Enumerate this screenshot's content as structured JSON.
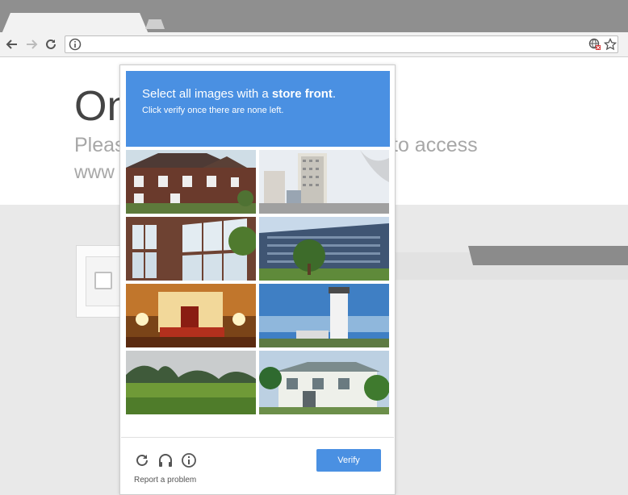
{
  "browser": {
    "tabs": [
      {
        "label": ""
      }
    ],
    "address": {
      "value": ""
    }
  },
  "page": {
    "heading": "On",
    "subtitle_left": "Pleas",
    "subtitle_right": "to access",
    "url_fragment": "www"
  },
  "challenge": {
    "instruction_prefix": "Select all images with a ",
    "instruction_target": "store front",
    "instruction_suffix": ".",
    "sub_instruction": "Click verify once there are none left.",
    "header_color": "#4a90e2",
    "tiles": [
      {
        "subject": "brick-house"
      },
      {
        "subject": "tower-buildings"
      },
      {
        "subject": "brick-building-windows"
      },
      {
        "subject": "office-building"
      },
      {
        "subject": "decorated-hall"
      },
      {
        "subject": "lighthouse"
      },
      {
        "subject": "rice-field-hills"
      },
      {
        "subject": "white-villa"
      }
    ],
    "footer": {
      "reload_icon": "reload-icon",
      "audio_icon": "headphones-icon",
      "info_icon": "info-icon",
      "verify_label": "Verify",
      "report_label": "Report a problem"
    }
  }
}
